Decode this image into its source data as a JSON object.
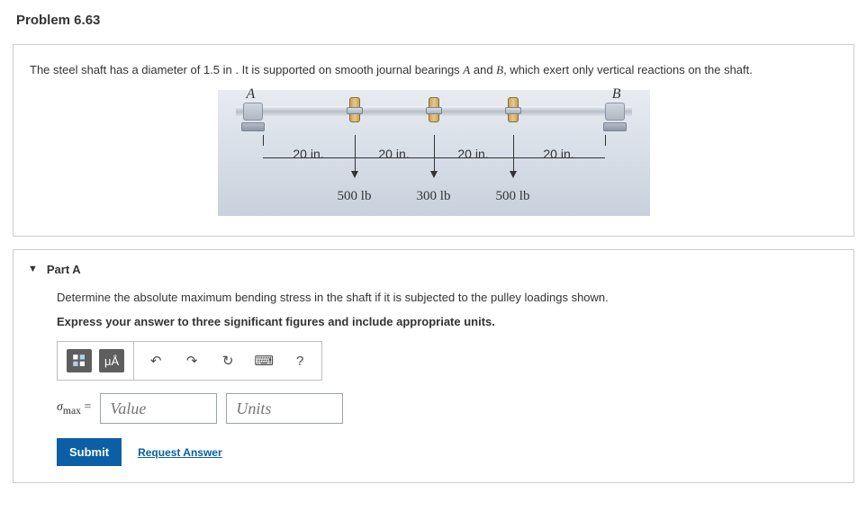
{
  "problem_title": "Problem 6.63",
  "statement_prefix": "The steel shaft has a diameter of ",
  "diameter": "1.5 in",
  "statement_mid": " . It is supported on smooth journal bearings ",
  "label_a": "A",
  "statement_and": " and ",
  "label_b": "B",
  "statement_suffix": ", which exert only vertical reactions on the shaft.",
  "diagram": {
    "A": "A",
    "B": "B",
    "dims": [
      "20 in.",
      "20 in.",
      "20 in.",
      "20 in."
    ],
    "loads": [
      "500 lb",
      "300 lb",
      "500 lb"
    ]
  },
  "part": {
    "label": "Part A",
    "question": "Determine the absolute maximum bending stress in the shaft if it is subjected to the pulley loadings shown.",
    "instruction": "Express your answer to three significant figures and include appropriate units.",
    "toolbar": {
      "templates_icon": "templates-icon",
      "units_btn": "μÅ",
      "undo": "↶",
      "redo": "↷",
      "reset": "↻",
      "keyboard": "⌨",
      "help": "?"
    },
    "var_sym_html": "σ",
    "var_sub": "max",
    "value_placeholder": "Value",
    "units_placeholder": "Units",
    "submit": "Submit",
    "request": "Request Answer"
  }
}
